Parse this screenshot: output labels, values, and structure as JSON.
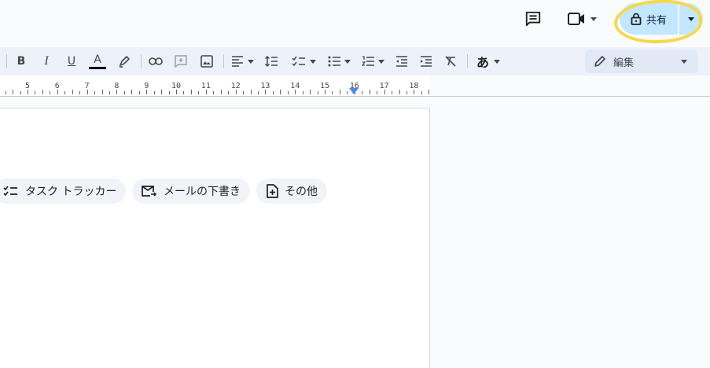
{
  "header": {
    "share_label": "共有"
  },
  "toolbar": {
    "bold": "B",
    "italic": "I",
    "underline": "U",
    "text_color": "A",
    "input_tools": "あ",
    "mode_label": "編集"
  },
  "ruler": {
    "numbers": [
      "5",
      "6",
      "7",
      "8",
      "9",
      "10",
      "11",
      "12",
      "13",
      "14",
      "15",
      "16",
      "17",
      "18"
    ]
  },
  "chips": [
    {
      "label": "タスク トラッカー",
      "icon": "checklist-icon"
    },
    {
      "label": "メールの下書き",
      "icon": "mail-draft-icon"
    },
    {
      "label": "その他",
      "icon": "note-add-icon"
    }
  ],
  "colors": {
    "share_bg": "#c2e7ff",
    "toolbar_bg": "#edf2fa",
    "highlight": "#f7d84a",
    "ruler_marker": "#4a8af4"
  }
}
